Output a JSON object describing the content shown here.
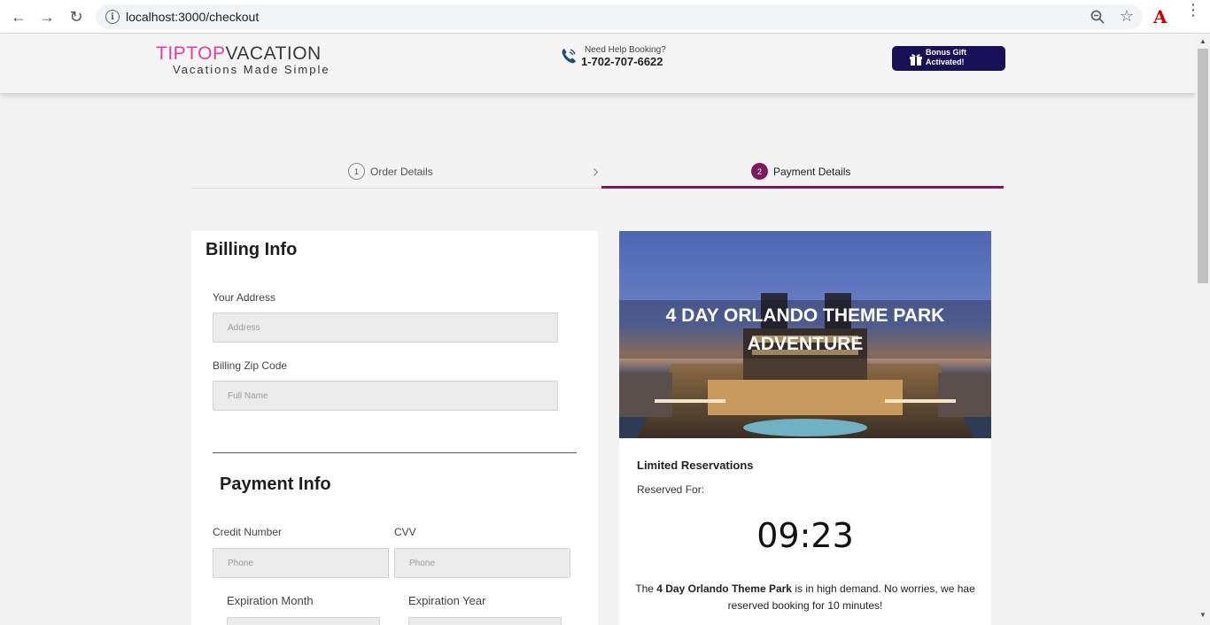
{
  "browser": {
    "url": "localhost:3000/checkout"
  },
  "header": {
    "brand_part1": "TIPTOP",
    "brand_part2": "VACATION",
    "tagline": "Vacations Made Simple",
    "help_label": "Need Help Booking?",
    "help_phone": "1-702-707-6622",
    "gift_line1": "Bonus Gift",
    "gift_line2": "Activated!"
  },
  "steps": [
    {
      "number": "1",
      "label": "Order Details"
    },
    {
      "number": "2",
      "label": "Payment Details"
    }
  ],
  "billing": {
    "title": "Billing Info",
    "address_label": "Your Address",
    "address_placeholder": "Address",
    "zip_label": "Billing Zip Code",
    "zip_placeholder": "Full Name"
  },
  "payment": {
    "title": "Payment Info",
    "credit_label": "Credit Number",
    "credit_placeholder": "Phone",
    "cvv_label": "CVV",
    "cvv_placeholder": "Phone",
    "exp_month_label": "Expiration Month",
    "exp_year_label": "Expiration Year"
  },
  "summary": {
    "title": "4 DAY ORLANDO THEME PARK ADVENTURE",
    "limited": "Limited Reservations",
    "reserved_for": "Reserved For:",
    "timer": "09:23",
    "demand_prefix": "The ",
    "demand_bold": "4 Day Orlando Theme Park",
    "demand_suffix": " is in high demand. No worries, we hae reserved booking for 10 minutes!"
  },
  "colors": {
    "accent": "#7b1a5e",
    "brand_pink": "#e03ea0",
    "gift_bg": "#1a1058"
  }
}
